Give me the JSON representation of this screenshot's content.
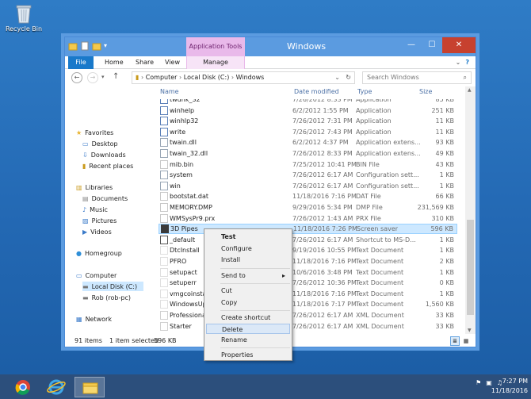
{
  "desktop": {
    "icon_label": "Recycle Bin"
  },
  "window": {
    "title": "Windows",
    "contextual_header": "Application Tools",
    "tabs": {
      "file": "File",
      "home": "Home",
      "share": "Share",
      "view": "View",
      "manage": "Manage"
    }
  },
  "address": {
    "crumbs": [
      "Computer",
      "Local Disk (C:)",
      "Windows"
    ],
    "search_placeholder": "Search Windows"
  },
  "nav": {
    "favorites": "Favorites",
    "desktop": "Desktop",
    "downloads": "Downloads",
    "recent": "Recent places",
    "libraries": "Libraries",
    "documents": "Documents",
    "music": "Music",
    "pictures": "Pictures",
    "videos": "Videos",
    "homegroup": "Homegroup",
    "computer": "Computer",
    "localdisk": "Local Disk (C:)",
    "rob": "Rob (rob-pc)",
    "network": "Network"
  },
  "columns": {
    "name": "Name",
    "date": "Date modified",
    "type": "Type",
    "size": "Size"
  },
  "files": [
    {
      "name": "twunk_32",
      "date": "7/26/2012 8:33 PM",
      "type": "Application",
      "size": "85 KB"
    },
    {
      "name": "winhelp",
      "date": "6/2/2012 1:55 PM",
      "type": "Application",
      "size": "251 KB"
    },
    {
      "name": "winhlp32",
      "date": "7/26/2012 7:31 PM",
      "type": "Application",
      "size": "11 KB"
    },
    {
      "name": "write",
      "date": "7/26/2012 7:43 PM",
      "type": "Application",
      "size": "11 KB"
    },
    {
      "name": "twain.dll",
      "date": "6/2/2012 4:37 PM",
      "type": "Application extens...",
      "size": "93 KB"
    },
    {
      "name": "twain_32.dll",
      "date": "7/26/2012 8:33 PM",
      "type": "Application extens...",
      "size": "49 KB"
    },
    {
      "name": "mib.bin",
      "date": "7/25/2012 10:41 PM",
      "type": "BIN File",
      "size": "43 KB"
    },
    {
      "name": "system",
      "date": "7/26/2012 6:17 AM",
      "type": "Configuration sett...",
      "size": "1 KB"
    },
    {
      "name": "win",
      "date": "7/26/2012 6:17 AM",
      "type": "Configuration sett...",
      "size": "1 KB"
    },
    {
      "name": "bootstat.dat",
      "date": "11/18/2016 7:16 PM",
      "type": "DAT File",
      "size": "66 KB"
    },
    {
      "name": "MEMORY.DMP",
      "date": "9/29/2016 5:34 PM",
      "type": "DMP File",
      "size": "231,569 KB"
    },
    {
      "name": "WMSysPr9.prx",
      "date": "7/26/2012 1:43 AM",
      "type": "PRX File",
      "size": "310 KB"
    },
    {
      "name": "3D Pipes",
      "date": "11/18/2016 7:26 PM",
      "type": "Screen saver",
      "size": "596 KB"
    },
    {
      "name": "_default",
      "date": "7/26/2012 6:17 AM",
      "type": "Shortcut to MS-D...",
      "size": "1 KB"
    },
    {
      "name": "DtcInstall",
      "date": "9/19/2016 10:55 PM",
      "type": "Text Document",
      "size": "1 KB"
    },
    {
      "name": "PFRO",
      "date": "11/18/2016 7:16 PM",
      "type": "Text Document",
      "size": "2 KB"
    },
    {
      "name": "setupact",
      "date": "10/6/2016 3:48 PM",
      "type": "Text Document",
      "size": "1 KB"
    },
    {
      "name": "setuperr",
      "date": "7/26/2012 10:36 PM",
      "type": "Text Document",
      "size": "0 KB"
    },
    {
      "name": "vmgcoinstall",
      "date": "11/18/2016 7:16 PM",
      "type": "Text Document",
      "size": "1 KB"
    },
    {
      "name": "WindowsUp",
      "date": "11/18/2016 7:17 PM",
      "type": "Text Document",
      "size": "1,560 KB"
    },
    {
      "name": "Professional",
      "date": "7/26/2012 6:17 AM",
      "type": "XML Document",
      "size": "33 KB"
    },
    {
      "name": "Starter",
      "date": "7/26/2012 6:17 AM",
      "type": "XML Document",
      "size": "33 KB"
    }
  ],
  "status": {
    "count": "91 items",
    "selected": "1 item selected",
    "size": "596 KB"
  },
  "menu": {
    "test": "Test",
    "configure": "Configure",
    "install": "Install",
    "send_to": "Send to",
    "cut": "Cut",
    "copy": "Copy",
    "create_shortcut": "Create shortcut",
    "delete": "Delete",
    "rename": "Rename",
    "properties": "Properties"
  },
  "taskbar": {
    "time": "7:27 PM",
    "date": "11/18/2016"
  }
}
